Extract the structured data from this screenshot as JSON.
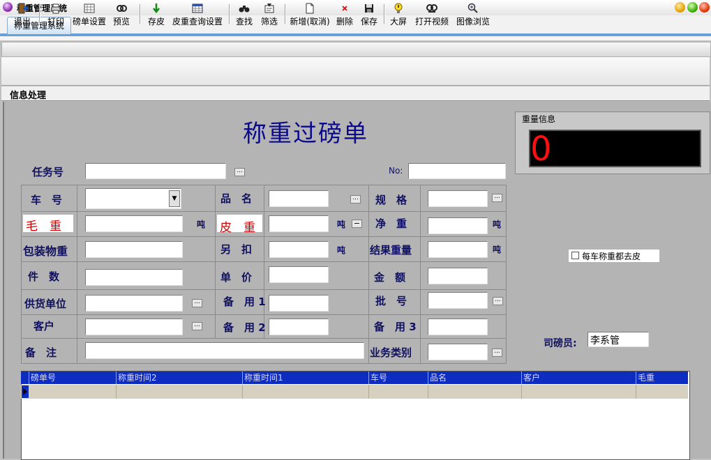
{
  "window": {
    "title": "称重管理系统"
  },
  "tab": {
    "label": "称重管理系统"
  },
  "toolbar": {
    "exit": "退出",
    "print": "打印",
    "slip_settings": "磅单设置",
    "preview": "预览",
    "save_tare": "存皮",
    "tare_query_settings": "皮重查询设置",
    "find": "查找",
    "filter": "筛选",
    "new": "新增(取消)",
    "delete": "删除",
    "save": "保存",
    "big_screen": "大屏",
    "open_video": "打开视频",
    "image_browse": "图像浏览"
  },
  "section_title": "信息处理",
  "form": {
    "title": "称重过磅单",
    "task_no_label": "任务号",
    "no_label": "No:",
    "labels": {
      "vehicle_no": "车　号",
      "product_name": "品　名",
      "spec": "规　格",
      "gross": "毛　重",
      "tare": "皮　重",
      "net": "净　重",
      "package_weight": "包装物重",
      "deduction": "另　扣",
      "result_weight": "结果重量",
      "pieces": "件　数",
      "unit_price": "单　价",
      "amount": "金　额",
      "supplier": "供货单位",
      "reserve1": "备　用 1",
      "batch_no": "批　号",
      "customer": "客户",
      "reserve2": "备　用 2",
      "reserve3": "备　用 3",
      "remark": "备　注",
      "business_type": "业务类别"
    },
    "unit_ton": "吨"
  },
  "weight_panel": {
    "title": "重量信息",
    "value": "0"
  },
  "checkbox": {
    "label": "每车称重都去皮",
    "checked": false
  },
  "operator": {
    "label": "司磅员:",
    "value": "李系管"
  },
  "grid": {
    "columns": [
      "磅单号",
      "称重时间2",
      "称重时间1",
      "车号",
      "品名",
      "客户",
      "毛重"
    ]
  },
  "colors": {
    "accent_blue": "#0d2dc0",
    "weight_red": "#ff1010",
    "label_navy": "#101060"
  }
}
